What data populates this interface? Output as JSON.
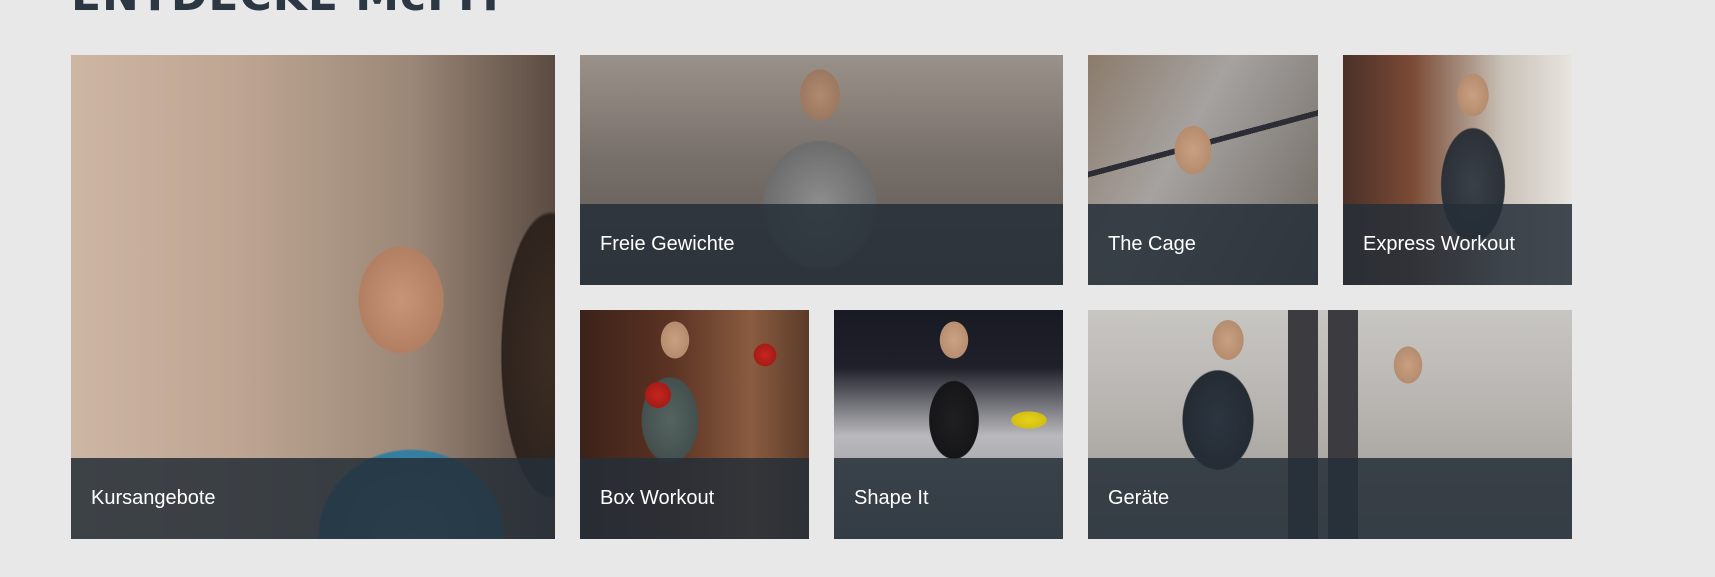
{
  "page": {
    "heading": "ENTDECKE McFIT"
  },
  "tiles": [
    {
      "id": "kursangebote",
      "label": "Kursangebote"
    },
    {
      "id": "freie-gewichte",
      "label": "Freie Gewichte"
    },
    {
      "id": "the-cage",
      "label": "The Cage"
    },
    {
      "id": "express-workout",
      "label": "Express Workout"
    },
    {
      "id": "box-workout",
      "label": "Box Workout"
    },
    {
      "id": "shape-it",
      "label": "Shape It"
    },
    {
      "id": "geraete",
      "label": "Geräte"
    }
  ],
  "colors": {
    "background": "#e8e8e8",
    "heading": "#2c3744",
    "caption_bar": "#252e38",
    "caption_text": "#ffffff"
  }
}
